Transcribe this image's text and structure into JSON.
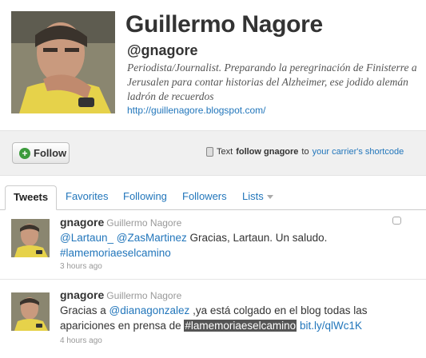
{
  "profile": {
    "name": "Guillermo Nagore",
    "handle": "@gnagore",
    "bio": "Periodista/Journalist. Preparando la peregrinación de Finisterre a Jerusalen para contar historias del Alzheimer, ese jodido alemán ladrón de recuerdos",
    "url": "http://guillenagore.blogspot.com/"
  },
  "follow_bar": {
    "follow_label": "Follow",
    "sms_prefix": "Text",
    "sms_command": "follow gnagore",
    "sms_to": "to",
    "sms_link": "your carrier's shortcode"
  },
  "tabs": [
    {
      "label": "Tweets"
    },
    {
      "label": "Favorites"
    },
    {
      "label": "Following"
    },
    {
      "label": "Followers"
    },
    {
      "label": "Lists"
    }
  ],
  "tweets": [
    {
      "user": "gnagore",
      "full_name": "Guillermo Nagore",
      "mention1": "@Lartaun_",
      "mention2": "@ZasMartinez",
      "text1": " Gracias, Lartaun. Un saludo.",
      "hashtag": "#lamemoriaeselcamino",
      "time": "3 hours ago"
    },
    {
      "user": "gnagore",
      "full_name": "Guillermo Nagore",
      "text_pre": "Gracias a ",
      "mention": "@dianagonzalez",
      "text_mid": " ,ya está colgado en el blog todas las apariciones en prensa de ",
      "hashtag": "#lamemoriaeselcamino",
      "link": "bit.ly/qlWc1K",
      "time": "4 hours ago"
    }
  ],
  "colors": {
    "link": "#2276bb",
    "follow_plus": "#3c9b3c",
    "bar_bg": "#f0f0f0"
  },
  "icons": [
    "follow-plus-icon",
    "phone-icon",
    "reply-icon",
    "caret-down-icon"
  ]
}
